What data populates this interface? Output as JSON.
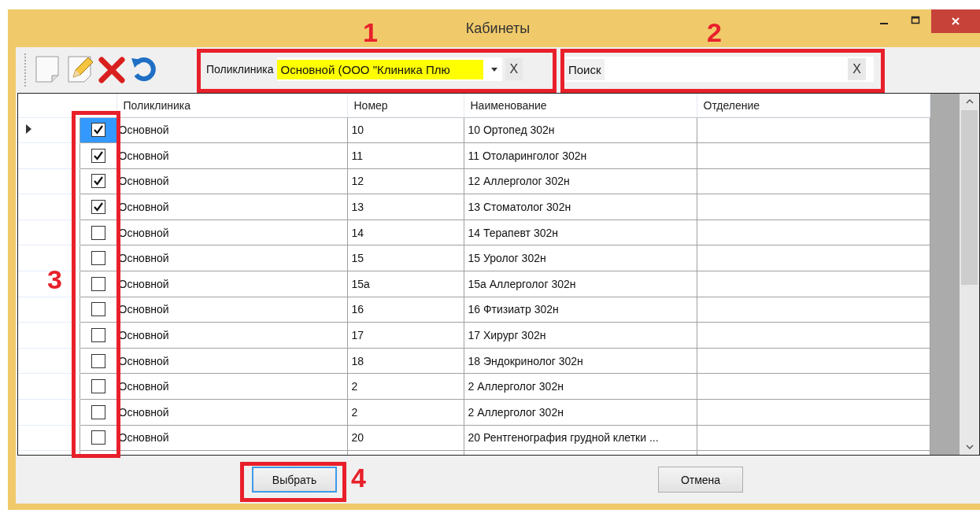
{
  "window": {
    "title": "Кабинеты"
  },
  "toolbar": {
    "filter": {
      "label": "Поликлиника",
      "value": "Основной (ООО \"Клиника Плю",
      "clear": "X"
    },
    "search": {
      "label": "Поиск",
      "clear": "X"
    }
  },
  "table": {
    "columns": [
      "Поликлиника",
      "Номер",
      "Наименование",
      "Отделение"
    ],
    "rows": [
      {
        "selected": true,
        "checked": true,
        "clinic": "Основной",
        "number": "10",
        "name": "10 Ортопед 302н"
      },
      {
        "selected": false,
        "checked": true,
        "clinic": "Основной",
        "number": "11",
        "name": "11 Отоларинголог 302н"
      },
      {
        "selected": false,
        "checked": true,
        "clinic": "Основной",
        "number": "12",
        "name": "12 Аллерголог 302н"
      },
      {
        "selected": false,
        "checked": true,
        "clinic": "Основной",
        "number": "13",
        "name": "13 Стоматолог 302н"
      },
      {
        "selected": false,
        "checked": false,
        "clinic": "Основной",
        "number": "14",
        "name": "14 Терапевт 302н"
      },
      {
        "selected": false,
        "checked": false,
        "clinic": "Основной",
        "number": "15",
        "name": "15 Уролог 302н"
      },
      {
        "selected": false,
        "checked": false,
        "clinic": "Основной",
        "number": "15а",
        "name": "15а Аллерголог 302н"
      },
      {
        "selected": false,
        "checked": false,
        "clinic": "Основной",
        "number": "16",
        "name": "16 Фтизиатр 302н"
      },
      {
        "selected": false,
        "checked": false,
        "clinic": "Основной",
        "number": "17",
        "name": "17 Хирург 302н"
      },
      {
        "selected": false,
        "checked": false,
        "clinic": "Основной",
        "number": "18",
        "name": "18 Эндокринолог 302н"
      },
      {
        "selected": false,
        "checked": false,
        "clinic": "Основной",
        "number": "2",
        "name": "2 Аллерголог 302н"
      },
      {
        "selected": false,
        "checked": false,
        "clinic": "Основной",
        "number": "2",
        "name": "2 Аллерголог 302н"
      },
      {
        "selected": false,
        "checked": false,
        "clinic": "Основной",
        "number": "20",
        "name": "20 Рентгенография грудной клетки ..."
      }
    ]
  },
  "buttons": [
    {
      "label": "Выбрать",
      "focused": true
    },
    {
      "label": "Отмена",
      "focused": false
    }
  ],
  "annotations": [
    {
      "label": "1"
    },
    {
      "label": "2"
    },
    {
      "label": "3"
    },
    {
      "label": "4"
    }
  ]
}
